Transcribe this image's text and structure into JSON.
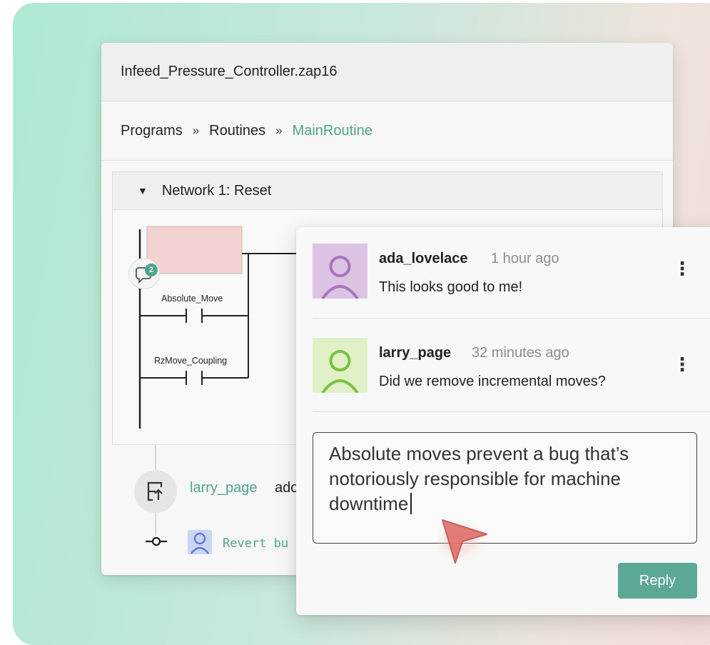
{
  "window": {
    "title": "Infeed_Pressure_Controller.zap16"
  },
  "breadcrumb": {
    "items": [
      "Programs",
      "Routines",
      "MainRoutine"
    ],
    "separator": "»"
  },
  "network": {
    "title": "Network 1: Reset",
    "contacts": [
      "Absolute_Move",
      "RzMove_Coupling"
    ],
    "comment_count": "2"
  },
  "history": {
    "user": "larry_page",
    "action_partial": "ado",
    "commit_message_partial": "Revert bu"
  },
  "comments": [
    {
      "user": "ada_lovelace",
      "time": "1 hour ago",
      "text": "This looks good to me!",
      "avatar_color": "#dcc3e4"
    },
    {
      "user": "larry_page",
      "time": "32 minutes ago",
      "text": "Did we remove incremental moves?",
      "avatar_color": "#dff0c6"
    }
  ],
  "reply": {
    "text": "Absolute moves prevent a bug that’s notoriously responsible for machine downtime",
    "button_label": "Reply"
  },
  "colors": {
    "accent": "#4fa48d",
    "reply_button": "#5ba897",
    "rung_box": "#f2d2d0",
    "cursor": "#e0706a"
  }
}
